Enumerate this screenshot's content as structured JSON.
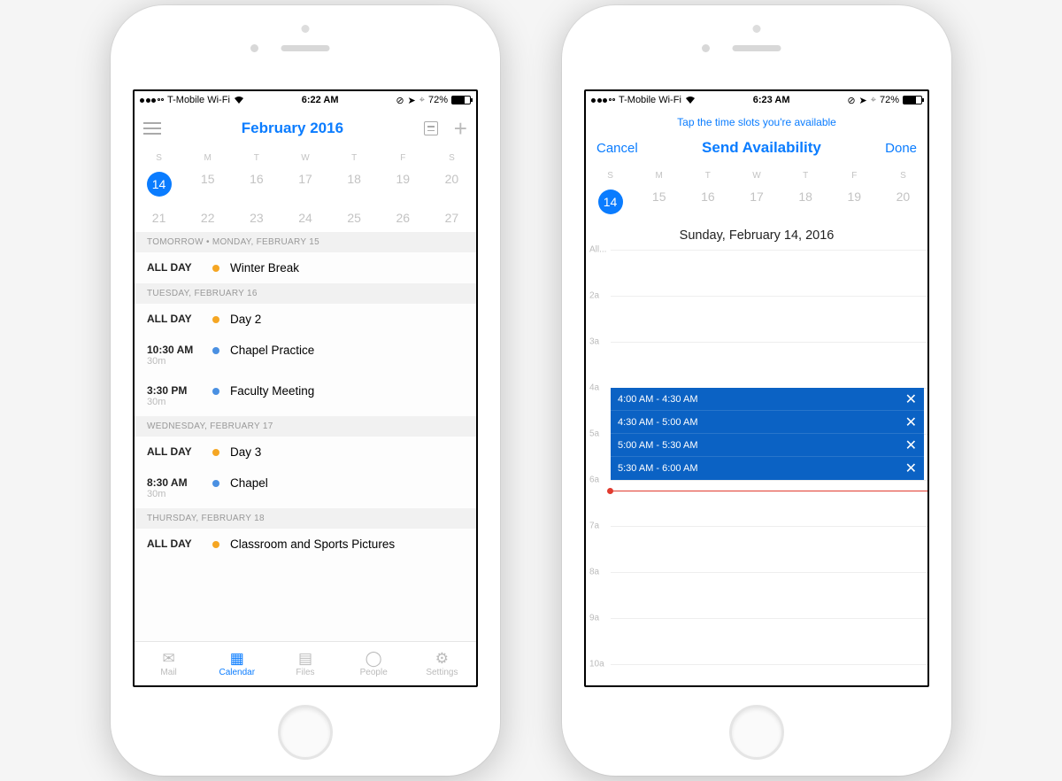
{
  "status": {
    "carrier": "T-Mobile Wi-Fi",
    "time_a": "6:22 AM",
    "time_b": "6:23 AM",
    "battery": "72%"
  },
  "phoneA": {
    "title": "February 2016",
    "dow": [
      "S",
      "M",
      "T",
      "W",
      "T",
      "F",
      "S"
    ],
    "row1": [
      "14",
      "15",
      "16",
      "17",
      "18",
      "19",
      "20"
    ],
    "row2": [
      "21",
      "22",
      "23",
      "24",
      "25",
      "26",
      "27"
    ],
    "selected": "14",
    "agenda": [
      {
        "header": "TOMORROW • MONDAY, FEBRUARY 15",
        "items": [
          {
            "time": "ALL DAY",
            "sub": "",
            "dot": "o",
            "title": "Winter Break"
          }
        ]
      },
      {
        "header": "TUESDAY, FEBRUARY 16",
        "items": [
          {
            "time": "ALL DAY",
            "sub": "",
            "dot": "o",
            "title": "Day 2"
          },
          {
            "time": "10:30 AM",
            "sub": "30m",
            "dot": "b",
            "title": "Chapel Practice"
          },
          {
            "time": "3:30 PM",
            "sub": "30m",
            "dot": "b",
            "title": "Faculty Meeting"
          }
        ]
      },
      {
        "header": "WEDNESDAY, FEBRUARY 17",
        "items": [
          {
            "time": "ALL DAY",
            "sub": "",
            "dot": "o",
            "title": "Day 3"
          },
          {
            "time": "8:30 AM",
            "sub": "30m",
            "dot": "b",
            "title": "Chapel"
          }
        ]
      },
      {
        "header": "THURSDAY, FEBRUARY 18",
        "items": [
          {
            "time": "ALL DAY",
            "sub": "",
            "dot": "o",
            "title": "Classroom and Sports Pictures"
          }
        ]
      }
    ],
    "tabs": [
      {
        "label": "Mail"
      },
      {
        "label": "Calendar"
      },
      {
        "label": "Files"
      },
      {
        "label": "People"
      },
      {
        "label": "Settings"
      }
    ]
  },
  "phoneB": {
    "hint": "Tap the time slots you're available",
    "cancel": "Cancel",
    "title": "Send Availability",
    "done": "Done",
    "dow": [
      "S",
      "M",
      "T",
      "W",
      "T",
      "F",
      "S"
    ],
    "row": [
      "14",
      "15",
      "16",
      "17",
      "18",
      "19",
      "20"
    ],
    "selected": "14",
    "date_label": "Sunday, February 14, 2016",
    "hours": [
      "All...",
      "2a",
      "3a",
      "4a",
      "5a",
      "6a",
      "7a",
      "8a",
      "9a",
      "10a"
    ],
    "slots": [
      "4:00 AM - 4:30 AM",
      "4:30 AM - 5:00 AM",
      "5:00 AM - 5:30 AM",
      "5:30 AM - 6:00 AM"
    ]
  }
}
